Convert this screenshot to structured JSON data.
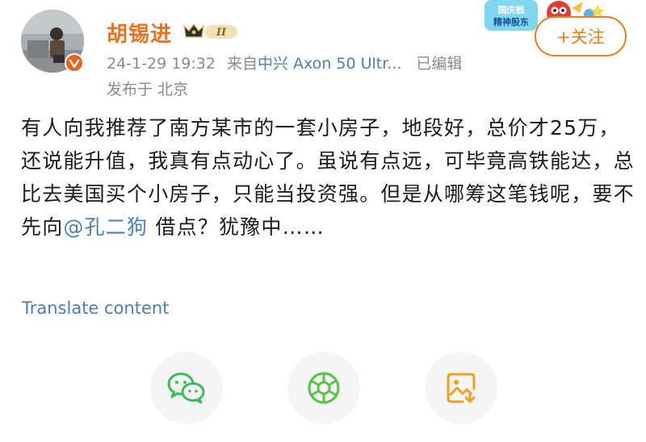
{
  "author": {
    "name": "胡锡进",
    "vip_level": "II",
    "avatar_caption": "胡锡进"
  },
  "meta": {
    "date": "24-1-29 19:32",
    "from_prefix": "来自",
    "device": "中兴 Axon 50 Ultr...",
    "edited": "已编辑",
    "location": "发布于 北京"
  },
  "sticker": {
    "text_line1": "国庆档",
    "text_line2": "精神股东"
  },
  "follow_button": {
    "label": "+关注"
  },
  "post": {
    "text_before": "有人向我推荐了南方某市的一套小房子，地段好，总价才25万，还说能升值，我真有点动心了。虽说有点远，可毕竟高铁能达，总比去美国买个小房子，只能当投资强。但是从哪筹这笔钱呢，要不先向",
    "mention": "@孔二狗",
    "text_after": " 借点？犹豫中……"
  },
  "translate": {
    "label": "Translate content"
  },
  "share": {
    "icons": [
      "wechat-icon",
      "moments-icon",
      "save-image-icon"
    ]
  },
  "colors": {
    "username": "#e8731e",
    "link": "#4a7fb8",
    "follow": "#ef7b1a",
    "wechat": "#3dbb5a",
    "moments": "#5cc14f",
    "save": "#f0a020"
  }
}
